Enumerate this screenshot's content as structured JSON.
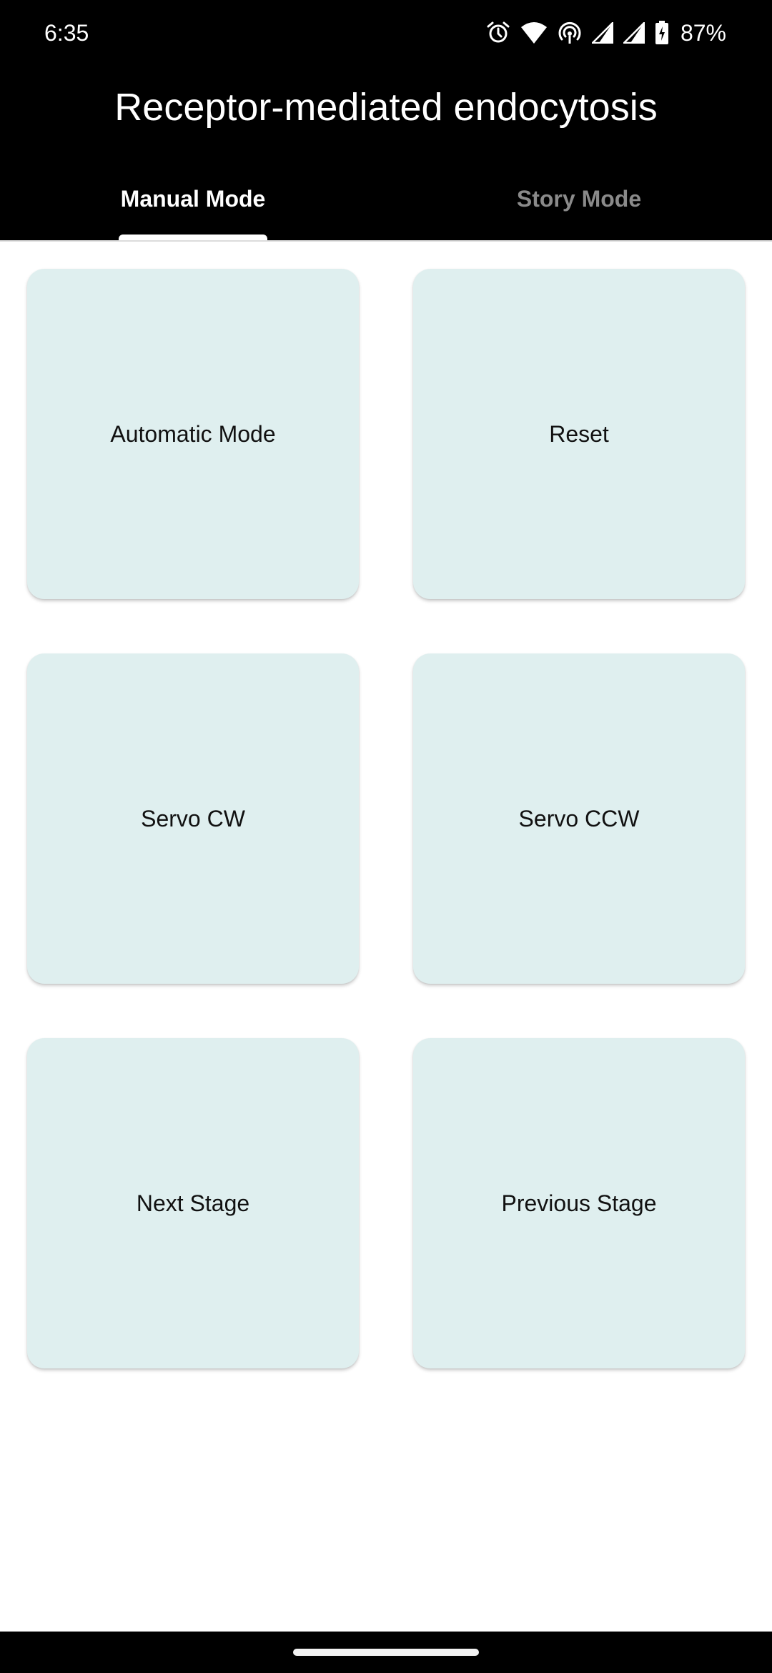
{
  "status_bar": {
    "time": "6:35",
    "battery_percent": "87%",
    "icons": [
      "alarm-icon",
      "wifi-icon",
      "hotspot-icon",
      "signal-icon",
      "signal-icon",
      "battery-charging-icon"
    ]
  },
  "app_bar": {
    "title": "Receptor-mediated endocytosis"
  },
  "tabs": [
    {
      "label": "Manual Mode",
      "selected": true
    },
    {
      "label": "Story Mode",
      "selected": false
    }
  ],
  "buttons": [
    {
      "label": "Automatic Mode"
    },
    {
      "label": "Reset"
    },
    {
      "label": "Servo CW"
    },
    {
      "label": "Servo CCW"
    },
    {
      "label": "Next Stage"
    },
    {
      "label": "Previous Stage"
    }
  ],
  "colors": {
    "app_bar_background": "#000000",
    "card_background": "#dfefef",
    "active_tab_text": "#ffffff",
    "inactive_tab_text": "#8a8a8a"
  }
}
